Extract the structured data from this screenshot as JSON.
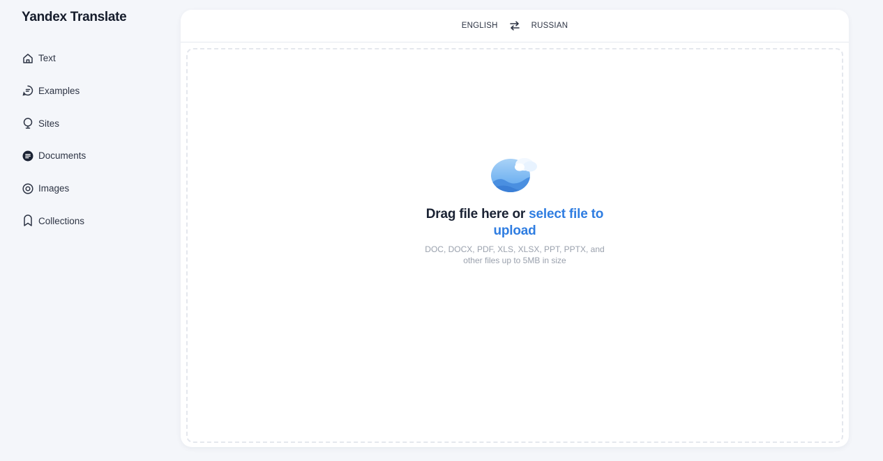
{
  "app": {
    "title": "Yandex Translate"
  },
  "sidebar": {
    "items": [
      {
        "label": "Text",
        "icon": "home-icon",
        "active": false
      },
      {
        "label": "Examples",
        "icon": "examples-icon",
        "active": false
      },
      {
        "label": "Sites",
        "icon": "globe-icon",
        "active": false
      },
      {
        "label": "Documents",
        "icon": "document-icon",
        "active": true
      },
      {
        "label": "Images",
        "icon": "image-icon",
        "active": false
      },
      {
        "label": "Collections",
        "icon": "bookmark-icon",
        "active": false
      }
    ]
  },
  "languages": {
    "source": "ENGLISH",
    "target": "RUSSIAN",
    "swap_icon": "swap-arrows-icon"
  },
  "upload": {
    "illustration": "image-upload-illustration",
    "title_prefix": "Drag file here or ",
    "title_link": "select file to upload",
    "hint": "DOC, DOCX, PDF, XLS, XLSX, PPT, PPTX, and other files up to 5MB in size"
  },
  "colors": {
    "accent": "#2f7de1",
    "background": "#f4f6fa",
    "active_icon": "#1a2233"
  }
}
